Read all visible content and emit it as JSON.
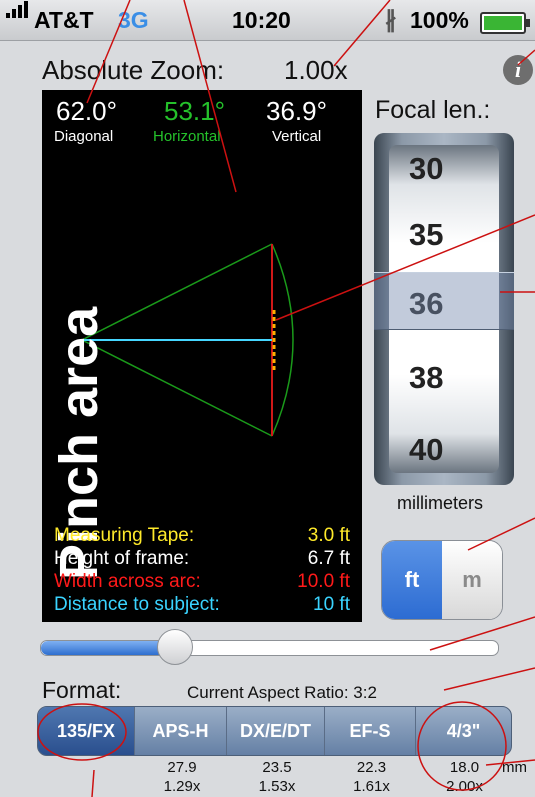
{
  "status": {
    "carrier": "AT&T",
    "network": "3G",
    "time": "10:20",
    "battery": "100%",
    "battery_level": 1.0
  },
  "zoom": {
    "label": "Absolute Zoom:",
    "value": "1.00x"
  },
  "info_icon": "info-icon",
  "angles": {
    "diagonal": {
      "value": "62.0°",
      "label": "Diagonal"
    },
    "horizontal": {
      "value": "53.1°",
      "label": "Horizontal"
    },
    "vertical": {
      "value": "36.9°",
      "label": "Vertical"
    }
  },
  "pinch_label": "Pinch area",
  "measurements": [
    {
      "label": "Measuring Tape:",
      "value": "3.0 ft",
      "color": "#ffea2a"
    },
    {
      "label": "Height of frame:",
      "value": "6.7 ft",
      "color": "#ffffff"
    },
    {
      "label": "Width across arc:",
      "value": "10.0 ft",
      "color": "#ff1a1a"
    },
    {
      "label": "Distance to subject:",
      "value": "10 ft",
      "color": "#3ad4ff"
    }
  ],
  "focal": {
    "title": "Focal len.:",
    "values": [
      "30",
      "35",
      "36",
      "38",
      "40"
    ],
    "selected": "36",
    "units": "millimeters"
  },
  "units_toggle": {
    "ft": "ft",
    "m": "m",
    "selected": "ft"
  },
  "slider": {
    "value": 0.29
  },
  "format": {
    "label": "Format:",
    "aspect_ratio": "Current Aspect Ratio: 3:2",
    "options": [
      {
        "label": "135/FX",
        "line1": "",
        "line2": ""
      },
      {
        "label": "APS-H",
        "line1": "27.9",
        "line2": "1.29x"
      },
      {
        "label": "DX/E/DT",
        "line1": "23.5",
        "line2": "1.53x"
      },
      {
        "label": "EF-S",
        "line1": "22.3",
        "line2": "1.61x"
      },
      {
        "label": "4/3\"",
        "line1": "18.0",
        "line2": "2.00x"
      }
    ],
    "selected": "135/FX",
    "unit_suffix": "mm"
  },
  "colors": {
    "horizontal_angle": "#25c12b",
    "sector_outline": "#1a9a1a",
    "width_line": "#d01818",
    "tape": "#ffb000",
    "distance_line": "#46d6ff",
    "callout": "#cc1111",
    "selected_segment": "#2a4f8e"
  }
}
